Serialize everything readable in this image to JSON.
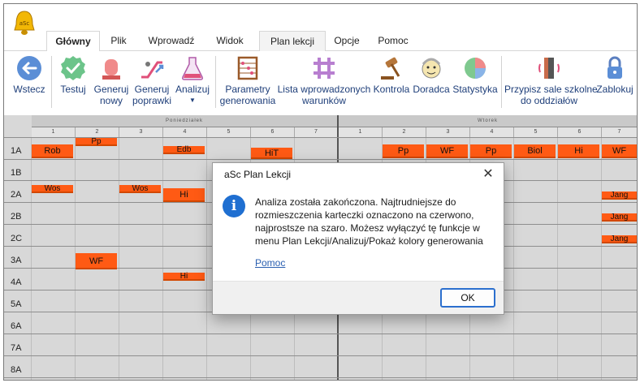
{
  "ribbon": {
    "tabs": [
      "Główny",
      "Plik",
      "Wprowadź",
      "Widok",
      "Plan lekcji",
      "Opcje",
      "Pomoc"
    ]
  },
  "toolbar": {
    "back": "Wstecz",
    "test": "Testuj",
    "generate_new": "Generuj\nnowy",
    "generate_fixes": "Generuj\npoprawki",
    "analyze": "Analizuj",
    "params": "Parametry\ngenerowania",
    "conditions": "Lista wprowadzonych\nwarunków",
    "control": "Kontrola",
    "advisor": "Doradca",
    "stats": "Statystyka",
    "assign_rooms": "Przypisz sale szkolne\ndo oddziałów",
    "lock": "Zablokuj"
  },
  "grid": {
    "days": [
      "Poniedziałek",
      "Wtorek"
    ],
    "periods": [
      "1",
      "2",
      "3",
      "4",
      "5",
      "6",
      "7"
    ],
    "rows": [
      "1A",
      "1B",
      "2A",
      "2B",
      "2C",
      "3A",
      "4A",
      "5A",
      "6A",
      "7A",
      "8A"
    ],
    "cards": {
      "c1": "Rob",
      "c2": "Pp",
      "c3": "Edb",
      "c4": "HiT",
      "c5": "Pp",
      "c6": "WF",
      "c7": "Pp",
      "c8": "Biol",
      "c9": "Hi",
      "c10": "WF",
      "c11": "Wos",
      "c12": "Wos",
      "c13": "Hi",
      "c14": "Jang",
      "c15": "Jang",
      "c16": "Jang",
      "c17": "WF",
      "c18": "Hi"
    }
  },
  "dialog": {
    "title": "aSc Plan Lekcji",
    "close": "✕",
    "icon": "i",
    "message": "Analiza została zakończona. Najtrudniejsze do rozmieszczenia karteczki oznaczono na czerwono, najprostsze na szaro. Możesz wyłączyć tę funkcje w menu Plan Lekcji/Analizuj/Pokaż kolory generowania",
    "help_link": "Pomoc",
    "ok": "OK"
  },
  "colors": {
    "card": "#ff5a14",
    "accent": "#2b6fce",
    "grid_bg": "#d8d8d8"
  }
}
